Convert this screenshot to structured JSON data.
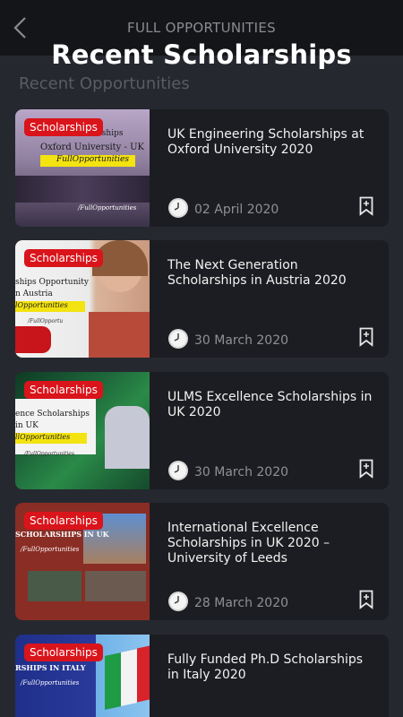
{
  "header": {
    "title": "FULL OPPORTUNITIES",
    "overlay_title": "Recent Scholarships"
  },
  "section_title": "Recent Opportunities",
  "category_badge": "Scholarships",
  "cards": [
    {
      "title": "UK Engineering Scholarships at Oxford University 2020",
      "date": "02 April 2020",
      "thumb_lines": [
        "cholarships",
        "Oxford University - UK",
        "FullOpportunities",
        "/FullOpportunities"
      ]
    },
    {
      "title": "The Next Generation Scholarships in Austria 2020",
      "date": "30 March 2020",
      "thumb_lines": [
        "ships Opportunity",
        "n Austria",
        "lOpportunities",
        "/FullOpportu"
      ]
    },
    {
      "title": "ULMS Excellence Scholarships in UK 2020",
      "date": "30 March 2020",
      "thumb_lines": [
        "ence Scholarships",
        "in UK",
        "llOpportunities",
        "/FullOpportunities"
      ]
    },
    {
      "title": "International Excellence Scholarships in UK 2020 – University of Leeds",
      "date": "28 March 2020",
      "thumb_lines": [
        "SCHOLARSHIPS IN UK",
        "/FullOpportunities",
        "",
        ""
      ]
    },
    {
      "title": "Fully Funded Ph.D Scholarships in Italy 2020",
      "date": "",
      "thumb_lines": [
        "RSHIPS IN ITALY",
        "/FullOpportunities",
        "",
        ""
      ]
    }
  ],
  "icons": {
    "back": "chevron-left-icon",
    "clock": "clock-icon",
    "bookmark": "bookmark-add-icon"
  },
  "colors": {
    "background": "#262830",
    "card": "#1c1d22",
    "badge": "#d9141b",
    "topbar": "#141519"
  }
}
